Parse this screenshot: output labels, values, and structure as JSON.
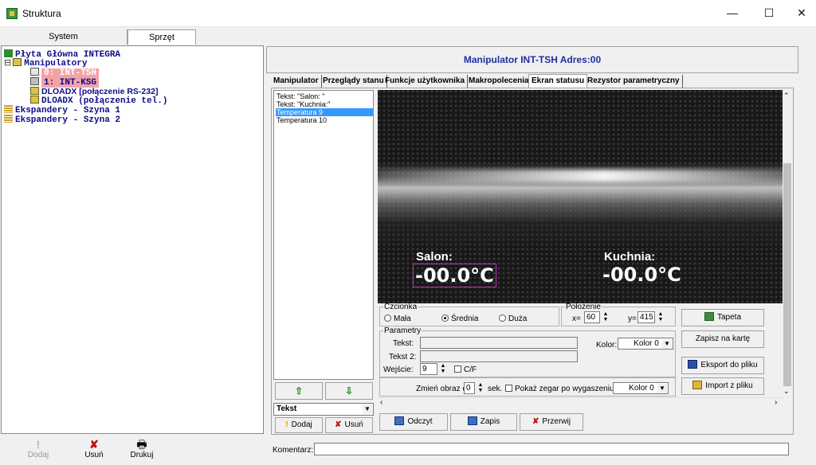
{
  "window": {
    "title": "Struktura",
    "minimize": "—",
    "maximize": "☐",
    "close": "✕"
  },
  "left_tabs": [
    "System",
    "Sprzęt"
  ],
  "tree": [
    {
      "text": "Płyta Główna INTEGRA",
      "icon": "board-icon"
    },
    {
      "text": "Manipulatory",
      "icon": "folder-icon",
      "expander": "⊟"
    },
    {
      "text": "0: INT-TSH",
      "icon": "keypad-icon",
      "selected": true
    },
    {
      "text": "1: INT-KSG",
      "icon": "keypad-icon",
      "selected": true
    },
    {
      "text": "DLOADX [połączenie RS-232]",
      "icon": "module-icon"
    },
    {
      "text": "DLOADX (połączenie tel.)",
      "icon": "module-icon"
    },
    {
      "text": "Ekspandery - Szyna 1",
      "icon": "bus-icon"
    },
    {
      "text": "Ekspandery - Szyna 2",
      "icon": "bus-icon"
    }
  ],
  "left_toolbar": {
    "add": "Dodaj",
    "remove": "Usuń",
    "print": "Drukuj"
  },
  "header": {
    "title": "Manipulator INT-TSH Adres:00"
  },
  "tabs": [
    "Manipulator",
    "Przeglądy stanu",
    "Funkcje użytkownika",
    "Makropolecenia",
    "Ekran statusu",
    "Rezystor parametryczny"
  ],
  "active_tab": "Ekran statusu",
  "element_list": [
    "Tekst: \"Salon: \"",
    "Tekst: \"Kuchnia:\"",
    "Temperatura 9",
    "Temperatura 10"
  ],
  "selected_element": "Temperatura 9",
  "list_controls": {
    "up": "⇧",
    "down": "⇩",
    "type_value": "Tekst",
    "add": "Dodaj",
    "remove": "Usuń"
  },
  "preview": {
    "label1": "Salon:",
    "value1": "-00.0°C",
    "label2": "Kuchnia:",
    "value2": "-00.0°C"
  },
  "font": {
    "legend": "Czcionka",
    "small": "Mała",
    "medium": "Średnia",
    "large": "Duża",
    "selected": "Średnia"
  },
  "position": {
    "legend": "Położenie",
    "x_label": "x=",
    "x_value": "60",
    "y_label": "y=",
    "y_value": "415"
  },
  "params": {
    "legend": "Parametry",
    "text_label": "Tekst:",
    "text2_label": "Tekst 2:",
    "input_label": "Wejście:",
    "input_value": "9",
    "cf_label": "C/F",
    "color_label": "Kolor:",
    "color_value": "Kolor 0"
  },
  "change_row": {
    "label": "Zmień obraz co:",
    "value": "0",
    "unit": "sek.",
    "clock_label": "Pokaż zegar po wygaszeniu",
    "color_value": "Kolor 0"
  },
  "side_buttons": {
    "wallpaper": "Tapeta",
    "save_card": "Zapisz na kartę",
    "export": "Eksport do pliku",
    "import": "Import z pliku"
  },
  "bottom_buttons": {
    "read": "Odczyt",
    "write": "Zapis",
    "abort": "Przerwij"
  },
  "comment": {
    "label": "Komentarz:",
    "value": ""
  }
}
